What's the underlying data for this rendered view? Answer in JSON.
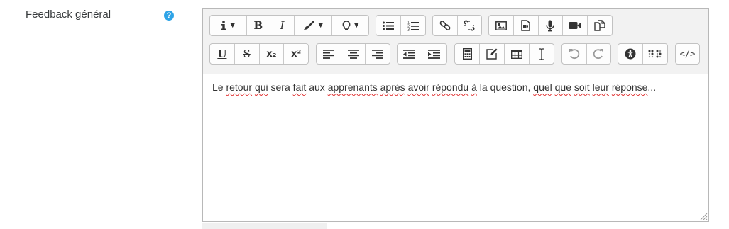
{
  "field": {
    "label": "Feedback général",
    "help_icon": "question-circle-icon",
    "help_glyph": "?"
  },
  "editor": {
    "content_segments": [
      {
        "text": "Le ",
        "spell": false
      },
      {
        "text": "retour",
        "spell": true
      },
      {
        "text": " ",
        "spell": false
      },
      {
        "text": "qui",
        "spell": true
      },
      {
        "text": " sera ",
        "spell": false
      },
      {
        "text": "fait",
        "spell": true
      },
      {
        "text": " aux ",
        "spell": false
      },
      {
        "text": "apprenants",
        "spell": true
      },
      {
        "text": " ",
        "spell": false
      },
      {
        "text": "après",
        "spell": true
      },
      {
        "text": " ",
        "spell": false
      },
      {
        "text": "avoir",
        "spell": true
      },
      {
        "text": " ",
        "spell": false
      },
      {
        "text": "répondu",
        "spell": true
      },
      {
        "text": " ",
        "spell": false
      },
      {
        "text": "à",
        "spell": true
      },
      {
        "text": " la question, ",
        "spell": false
      },
      {
        "text": "quel",
        "spell": true
      },
      {
        "text": " ",
        "spell": false
      },
      {
        "text": "que",
        "spell": true
      },
      {
        "text": " ",
        "spell": false
      },
      {
        "text": "soit",
        "spell": true
      },
      {
        "text": " ",
        "spell": false
      },
      {
        "text": "leur",
        "spell": true
      },
      {
        "text": " ",
        "spell": false
      },
      {
        "text": "réponse",
        "spell": true
      },
      {
        "text": "...",
        "spell": false
      }
    ],
    "toolbar": {
      "row1": [
        [
          "info-dropdown-icon",
          "bold-button-icon",
          "italic-button-icon",
          "text-color-dropdown-icon",
          "lightbulb-dropdown-icon"
        ],
        [
          "unordered-list-icon",
          "ordered-list-icon"
        ],
        [
          "link-icon",
          "unlink-icon"
        ],
        [
          "image-icon",
          "media-icon",
          "record-audio-icon",
          "record-video-icon",
          "manage-files-icon"
        ]
      ],
      "row2": [
        [
          "underline-icon",
          "strikethrough-icon",
          "subscript-icon",
          "superscript-icon"
        ],
        [
          "align-left-icon",
          "align-center-icon",
          "align-right-icon"
        ],
        [
          "outdent-icon",
          "indent-icon"
        ],
        [
          "equation-icon",
          "edit-icon",
          "table-icon",
          "cursor-icon"
        ],
        [
          "undo-icon",
          "redo-icon"
        ],
        [
          "accessibility-checker-icon",
          "screenreader-helper-icon"
        ],
        [
          "html-source-icon"
        ]
      ],
      "glyphs": {
        "bold": "B",
        "italic": "I",
        "underline": "U",
        "strike": "S",
        "sub": "x₂",
        "sup": "x²",
        "html": "</>"
      },
      "disabled": [
        "undo-icon",
        "redo-icon"
      ]
    }
  }
}
